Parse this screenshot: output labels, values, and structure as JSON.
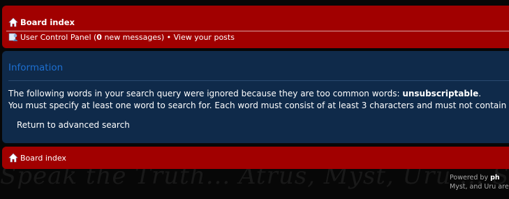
{
  "nav": {
    "board_index": "Board index",
    "ucp_prefix": "User Control Panel (",
    "message_count": "0",
    "ucp_suffix": " new messages)",
    "separator": " • ",
    "view_posts": "View your posts"
  },
  "panel": {
    "title": "Information",
    "line1_text": "The following words in your search query were ignored because they are too common words: ",
    "ignored_word": "unsubscriptable",
    "line1_end": ".",
    "line2": "You must specify at least one word to search for. Each word must consist of at least 3 characters and must not contain",
    "return_link": "Return to advanced search"
  },
  "footer": {
    "powered_by": "Powered by ",
    "powered_name": "ph",
    "line2": "Myst, and Uru are c"
  },
  "background_text": "Speak the Truth... Atrus, Myst, Uru ... Speak the Truth...",
  "colors": {
    "navbar": "#a10000",
    "panel": "#0f2a4a",
    "panel_title": "#1d6fd0",
    "background": "#070707"
  }
}
